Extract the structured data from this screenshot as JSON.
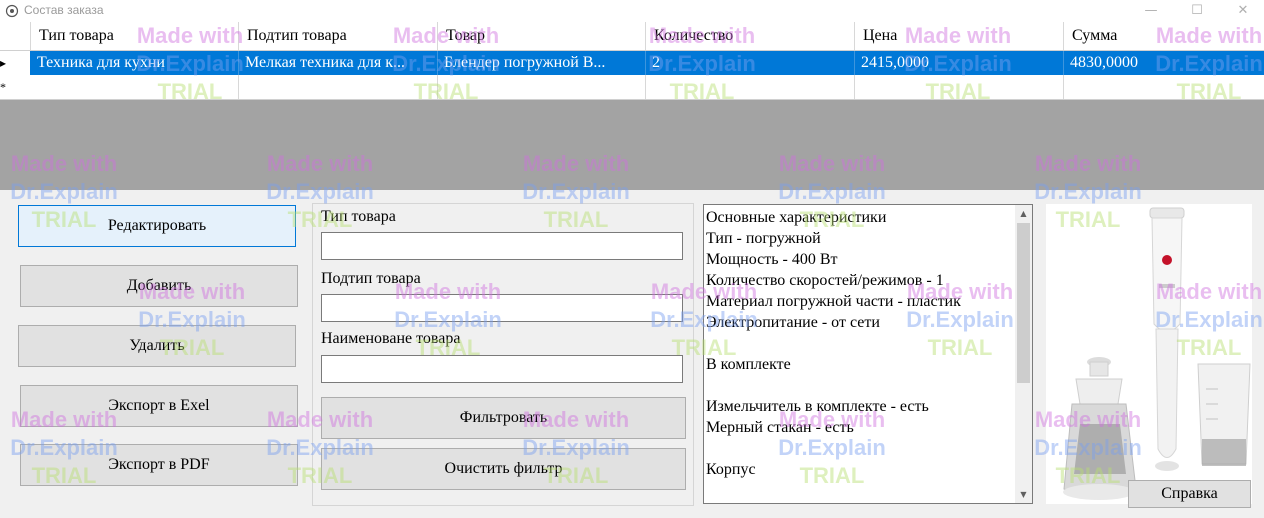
{
  "window": {
    "title": "Состав заказа",
    "icon": "app-icon",
    "controls": {
      "minimize": "—",
      "maximize": "☐",
      "close": "✕"
    }
  },
  "grid": {
    "columns": [
      "Тип товара",
      "Подтип товара",
      "Товар",
      "Количество",
      "Цена",
      "Сумма"
    ],
    "rows": [
      {
        "marker": "▸",
        "cells": [
          "Техника для кухни",
          "Мелкая техника для к...",
          "Блендер погружной B...",
          "2",
          "2415,0000",
          "4830,0000"
        ]
      }
    ],
    "new_row_marker": "*"
  },
  "actions": {
    "edit": "Редактировать",
    "add": "Добавить",
    "delete": "Удалить",
    "export_excel": "Экспорт в Exel",
    "export_pdf": "Экспорт в PDF"
  },
  "filter": {
    "type_label": "Тип товара",
    "type_value": "",
    "subtype_label": "Подтип товара",
    "subtype_value": "",
    "name_label": "Наименоване товара",
    "name_value": "",
    "apply": "Фильтровать",
    "clear": "Очистить фильтр"
  },
  "description": {
    "lines": [
      "Основные характеристики",
      "Тип - погружной",
      "Мощность - 400 Вт",
      "Количество скоростей/режимов - 1",
      "Материал погружной части - пластик",
      "Электропитание - от сети",
      "",
      "В комплекте",
      "",
      "Измельчитель в комплекте - есть",
      "Мерный стакан - есть",
      "",
      "Корпус"
    ]
  },
  "help_button": "Справка",
  "watermark": {
    "line1": "Made with",
    "line2": "Dr.Explain",
    "line3": "TRIAL"
  },
  "colors": {
    "selection": "#0078d7",
    "grid_bg": "#a3a3a3",
    "button_bg": "#e1e1e1",
    "focus_border": "#0078d7"
  }
}
